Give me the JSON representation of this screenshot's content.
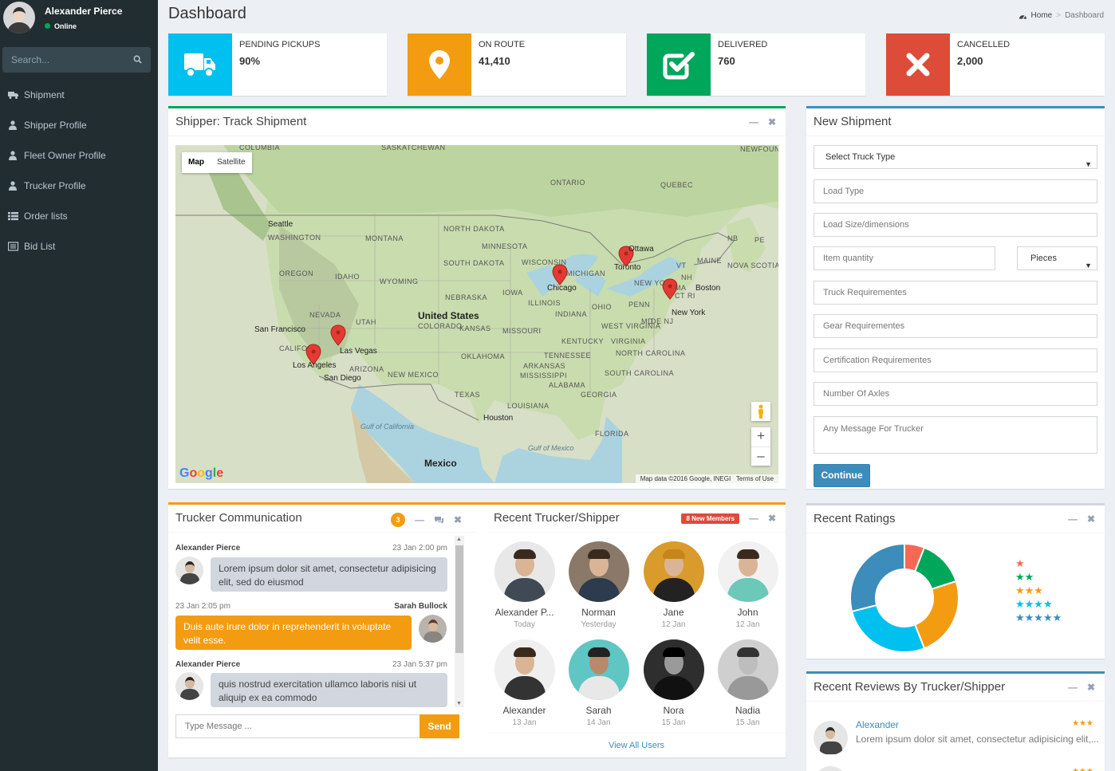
{
  "sidebar": {
    "user_name": "Alexander Pierce",
    "status": "Online",
    "search_placeholder": "Search...",
    "menu": [
      {
        "label": "Shipment",
        "icon": "truck-icon"
      },
      {
        "label": "Shipper Profile",
        "icon": "user-icon"
      },
      {
        "label": "Fleet Owner Profile",
        "icon": "user-icon"
      },
      {
        "label": "Trucker Profile",
        "icon": "user-icon"
      },
      {
        "label": "Order lists",
        "icon": "th-list-icon"
      },
      {
        "label": "Bid List",
        "icon": "list-alt-icon"
      }
    ]
  },
  "header": {
    "title": "Dashboard",
    "breadcrumb": {
      "home": "Home",
      "current": "Dashboard"
    }
  },
  "info_boxes": [
    {
      "label": "PENDING PICKUPS",
      "value": "90%",
      "color": "#00c0ef",
      "icon": "truck-icon"
    },
    {
      "label": "ON ROUTE",
      "value": "41,410",
      "color": "#f39c12",
      "icon": "map-marker-icon"
    },
    {
      "label": "DELIVERED",
      "value": "760",
      "color": "#00a65a",
      "icon": "check-square-icon"
    },
    {
      "label": "CANCELLED",
      "value": "2,000",
      "color": "#dd4b39",
      "icon": "times-icon"
    }
  ],
  "track": {
    "title": "Shipper: Track Shipment",
    "map_type_map": "Map",
    "map_type_satellite": "Satellite",
    "map_attribution_data": "Map data ©2016 Google, INEGI",
    "map_attribution_terms": "Terms of Use",
    "google": "Google",
    "labels": [
      "COLUMBIA",
      "SASKATCHEWAN",
      "ONTARIO",
      "QUEBEC",
      "NEWFOUN AND LAB",
      "Seattle",
      "WASHINGTON",
      "MONTANA",
      "NORTH DAKOTA",
      "MINNESOTA",
      "OREGON",
      "IDAHO",
      "WYOMING",
      "SOUTH DAKOTA",
      "WISCONSIN",
      "MICHIGAN",
      "Ottawa",
      "Toronto",
      "VT",
      "NB",
      "PE",
      "MAINE",
      "NOVA SCOTIA",
      "NH",
      "MA",
      "Boston",
      "CT RI",
      "NEW YO",
      "Chicago",
      "IOWA",
      "NEBRASKA",
      "ILLINOIS",
      "OHIO",
      "PENN",
      "NEVADA",
      "UTAH",
      "United States",
      "COLORADO",
      "KANSAS",
      "MISSOURI",
      "INDIANA",
      "WEST VIRGINIA",
      "MD",
      "DE NJ",
      "New York",
      "San Francisco",
      "CALIFO",
      "Las Vegas",
      "Los Angeles",
      "San Diego",
      "ARIZONA",
      "NEW MEXICO",
      "OKLAHOMA",
      "ARKANSAS",
      "KENTUCKY",
      "VIRGINIA",
      "TENNESSEE",
      "NORTH CAROLINA",
      "SOUTH CAROLINA",
      "MISSISSIPPI",
      "ALABAMA",
      "GEORGIA",
      "TEXAS",
      "LOUISIANA",
      "Houston",
      "FLORIDA",
      "Gulf of Mexico",
      "Mexico",
      "Gulf of California"
    ]
  },
  "new_shipment": {
    "title": "New Shipment",
    "truck_type": "Select Truck Type",
    "load_type": "Load Type",
    "load_size": "Load Size/dimensions",
    "item_quantity": "Item quantity",
    "unit": "Pieces",
    "truck_req": "Truck Requirementes",
    "gear_req": "Gear Requirementes",
    "cert_req": "Certification Requirementes",
    "axles": "Number Of Axles",
    "message": "Any Message For Trucker",
    "continue": "Continue"
  },
  "chat": {
    "title": "Trucker Communication",
    "badge": "3",
    "messages": [
      {
        "name": "Alexander Pierce",
        "time": "23 Jan 2:00 pm",
        "text": "Lorem ipsum dolor sit amet, consectetur adipisicing elit, sed do eiusmod",
        "side": "left"
      },
      {
        "name": "Sarah Bullock",
        "time": "23 Jan 2:05 pm",
        "text": "Duis aute irure dolor in reprehenderit in voluptate velit esse.",
        "side": "right"
      },
      {
        "name": "Alexander Pierce",
        "time": "23 Jan 5:37 pm",
        "text": "quis nostrud exercitation ullamco laboris nisi ut aliquip ex ea commodo",
        "side": "left"
      }
    ],
    "input_placeholder": "Type Message ...",
    "send": "Send"
  },
  "recent_users": {
    "title": "Recent Trucker/Shipper",
    "badge": "8 New Members",
    "users": [
      {
        "name": "Alexander P...",
        "date": "Today"
      },
      {
        "name": "Norman",
        "date": "Yesterday"
      },
      {
        "name": "Jane",
        "date": "12 Jan"
      },
      {
        "name": "John",
        "date": "12 Jan"
      },
      {
        "name": "Alexander",
        "date": "13 Jan"
      },
      {
        "name": "Sarah",
        "date": "14 Jan"
      },
      {
        "name": "Nora",
        "date": "15 Jan"
      },
      {
        "name": "Nadia",
        "date": "15 Jan"
      }
    ],
    "view_all": "View All Users"
  },
  "ratings": {
    "title": "Recent Ratings",
    "segments": [
      {
        "value": 6,
        "color": "#f56954"
      },
      {
        "value": 14,
        "color": "#00a65a"
      },
      {
        "value": 24,
        "color": "#f39c12"
      },
      {
        "value": 27,
        "color": "#00c0ef"
      },
      {
        "value": 29,
        "color": "#3c8dbc"
      }
    ],
    "star_rows": [
      {
        "count": 1,
        "color": "#f56954"
      },
      {
        "count": 2,
        "color": "#00a65a"
      },
      {
        "count": 3,
        "color": "#f39c12"
      },
      {
        "count": 4,
        "color": "#00c0ef"
      },
      {
        "count": 5,
        "color": "#3c8dbc"
      }
    ]
  },
  "reviews": {
    "title": "Recent Reviews By Trucker/Shipper",
    "items": [
      {
        "name": "Alexander",
        "stars": 3,
        "text": "Lorem ipsum dolor sit amet, consectetur adipisicing elit,..."
      }
    ]
  }
}
